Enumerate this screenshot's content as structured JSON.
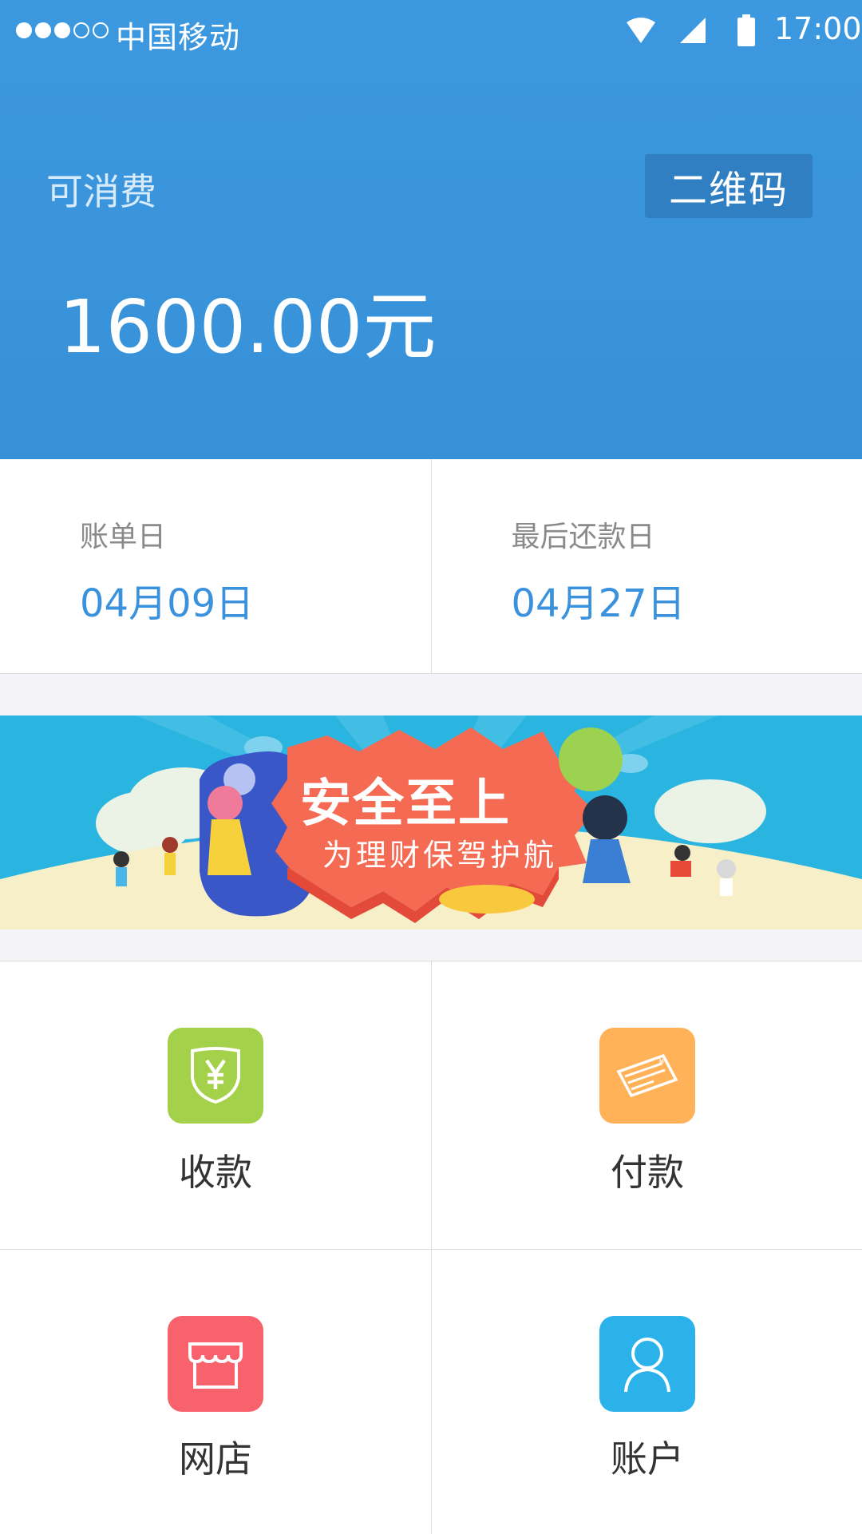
{
  "status_bar": {
    "carrier": "中国移动",
    "time": "17:00",
    "signal_dots_filled": 3,
    "signal_dots_total": 5
  },
  "header": {
    "balance_label": "可消费",
    "qr_button": "二维码",
    "balance_amount": "1600.00元",
    "background_color": "#3a95dc"
  },
  "dates": [
    {
      "title": "账单日",
      "value": "04月09日"
    },
    {
      "title": "最后还款日",
      "value": "04月27日"
    }
  ],
  "banner": {
    "title": "安全至上",
    "subtitle": "为理财保驾护航"
  },
  "tiles": [
    {
      "label": "收款",
      "icon": "yen-shield-icon",
      "color": "#a4d14a"
    },
    {
      "label": "付款",
      "icon": "banknote-icon",
      "color": "#ffb257"
    },
    {
      "label": "网店",
      "icon": "shop-icon",
      "color": "#f7626d"
    },
    {
      "label": "账户",
      "icon": "user-icon",
      "color": "#2cb2ea"
    }
  ],
  "colors": {
    "accent": "#3a92dd",
    "qr_button_bg": "#2f7fc2"
  }
}
